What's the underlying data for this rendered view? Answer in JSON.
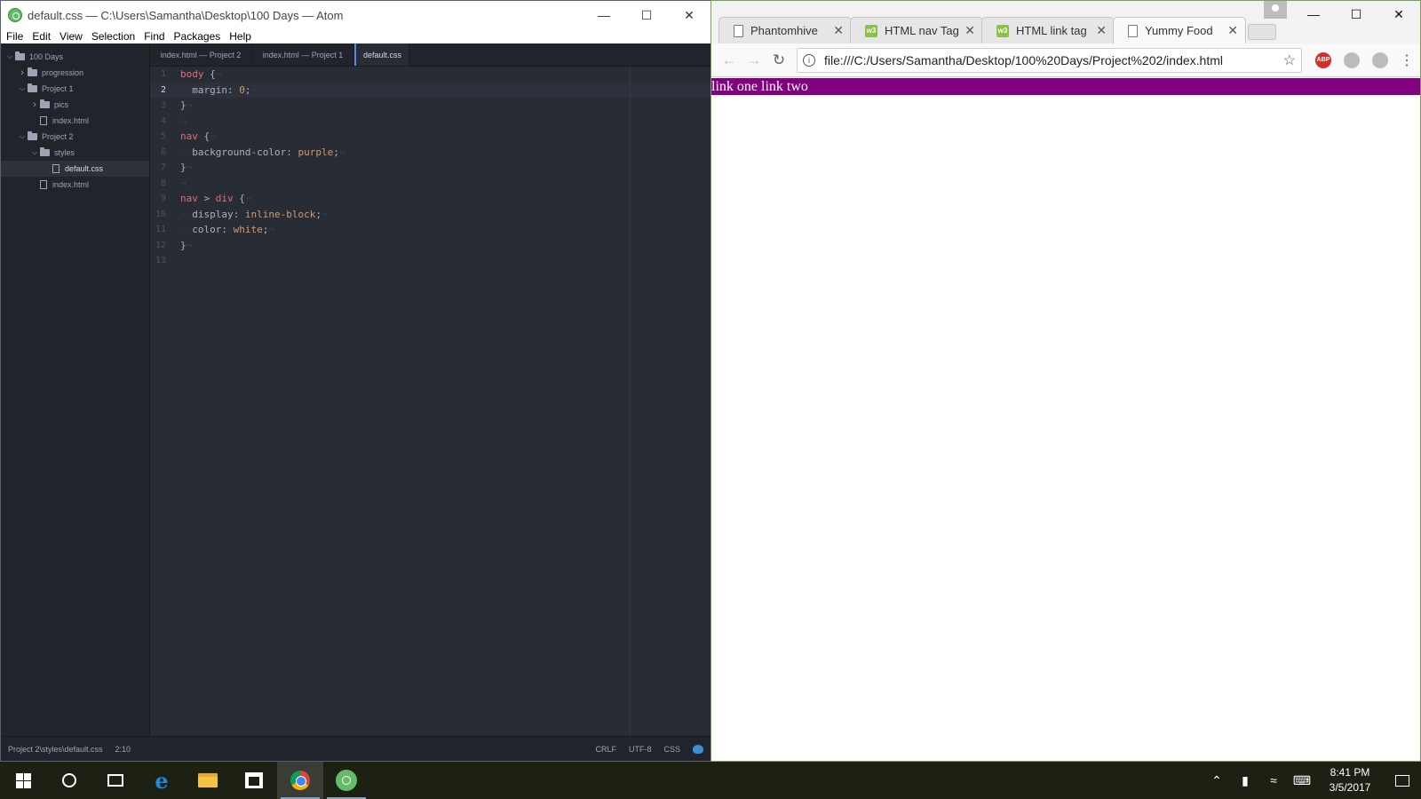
{
  "atom": {
    "title": "default.css — C:\\Users\\Samantha\\Desktop\\100 Days — Atom",
    "menu": [
      "File",
      "Edit",
      "View",
      "Selection",
      "Find",
      "Packages",
      "Help"
    ],
    "tree": [
      {
        "label": "100 Days",
        "indent": 0,
        "kind": "folder",
        "open": true
      },
      {
        "label": "progression",
        "indent": 1,
        "kind": "folder",
        "open": false
      },
      {
        "label": "Project 1",
        "indent": 1,
        "kind": "folder",
        "open": true
      },
      {
        "label": "pics",
        "indent": 2,
        "kind": "folder",
        "open": false
      },
      {
        "label": "index.html",
        "indent": 2,
        "kind": "file"
      },
      {
        "label": "Project 2",
        "indent": 1,
        "kind": "folder",
        "open": true
      },
      {
        "label": "styles",
        "indent": 2,
        "kind": "folder",
        "open": true
      },
      {
        "label": "default.css",
        "indent": 3,
        "kind": "file",
        "selected": true
      },
      {
        "label": "index.html",
        "indent": 2,
        "kind": "file"
      }
    ],
    "tabs": [
      {
        "label": "index.html — Project 2",
        "active": false
      },
      {
        "label": "index.html — Project 1",
        "active": false
      },
      {
        "label": "default.css",
        "active": true
      }
    ],
    "code_lines": [
      "body {",
      "  margin: 0;",
      "}",
      "",
      "nav {",
      "  background-color: purple;",
      "}",
      "",
      "nav > div {",
      "  display: inline-block;",
      "  color: white;",
      "}",
      ""
    ],
    "current_line": 2,
    "status": {
      "path": "Project 2\\styles\\default.css",
      "cursor": "2:10",
      "line_ending": "CRLF",
      "encoding": "UTF-8",
      "grammar": "CSS"
    }
  },
  "chrome": {
    "tabs": [
      {
        "label": "Phantomhive",
        "icon": "page-icon",
        "active": false
      },
      {
        "label": "HTML nav Tag",
        "icon": "w3schools-icon",
        "active": false
      },
      {
        "label": "HTML link tag",
        "icon": "w3schools-icon",
        "active": false
      },
      {
        "label": "Yummy Food",
        "icon": "page-icon",
        "active": true
      }
    ],
    "url": "file:///C:/Users/Samantha/Desktop/100%20Days/Project%202/index.html",
    "page": {
      "links": [
        "link one",
        "link two"
      ]
    }
  },
  "taskbar": {
    "time": "8:41 PM",
    "date": "3/5/2017"
  },
  "colors": {
    "nav_bg": "#800080",
    "atom_bg": "#282c34"
  }
}
